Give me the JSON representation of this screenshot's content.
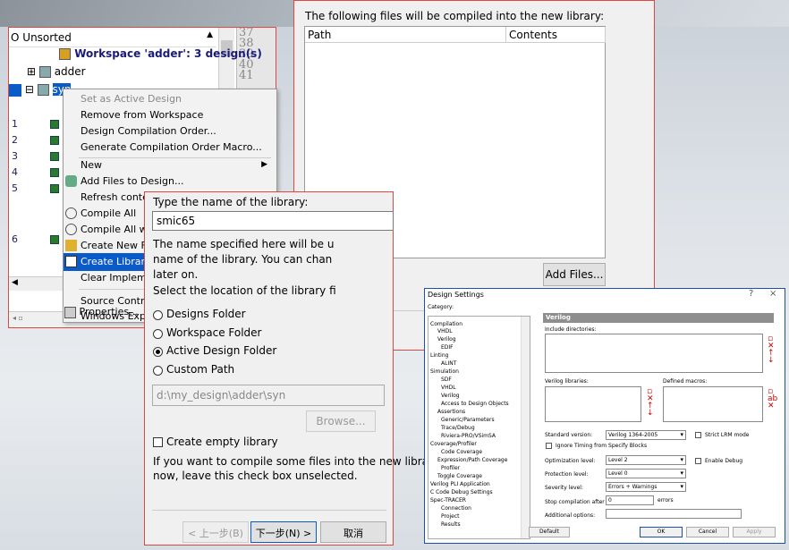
{
  "workspace": {
    "header": "Unsorted",
    "header_prefix": "O",
    "line_numbers": [
      "37",
      "38",
      "39",
      "40",
      "41"
    ],
    "workspace_label": "Workspace 'adder': 3 design(s)",
    "design1": "adder",
    "design2": "syn",
    "rows": [
      "1",
      "2",
      "3",
      "4",
      "5",
      "6"
    ]
  },
  "context_menu": {
    "items": [
      {
        "label": "Set as Active Design",
        "disabled": true
      },
      {
        "label": "Remove from Workspace"
      },
      {
        "label": "Design Compilation Order..."
      },
      {
        "label": "Generate Compilation Order Macro..."
      },
      {
        "label": "New"
      },
      {
        "label": "Add Files to Design..."
      },
      {
        "label": "Refresh contents..."
      },
      {
        "label": "Compile All"
      },
      {
        "label": "Compile All with"
      },
      {
        "label": "Create New Fo"
      },
      {
        "label": "Create Library..."
      },
      {
        "label": "Clear Implemen"
      },
      {
        "label": "Source Control"
      },
      {
        "label": "Windows Explo"
      },
      {
        "label": "Properties..."
      }
    ]
  },
  "compile_dialog": {
    "title": "The following files will be compiled into the new library:",
    "col_path": "Path",
    "col_contents": "Contents",
    "add_files": "Add Files..."
  },
  "library_dialog": {
    "prompt": "Type the name of the library:",
    "name_value": "smic65",
    "note1": "The name specified here will be u",
    "note2": "name of the library. You can chan",
    "note3": "later on.",
    "location_prompt": "Select the location of the library fi",
    "options": [
      "Designs Folder",
      "Workspace Folder",
      "Active Design Folder",
      "Custom Path"
    ],
    "selected_option": "Active Design Folder",
    "path_value": "d:\\my_design\\adder\\syn",
    "browse": "Browse...",
    "empty_lib": "Create empty library",
    "hint1": "If you want to compile some files into the new library",
    "hint2": "now, leave this check box unselected.",
    "back": "< 上一步(B)",
    "next": "下一步(N) >",
    "cancel": "取消"
  },
  "design_settings": {
    "title": "Design Settings",
    "help": "?",
    "close": "×",
    "category": "Category:",
    "tree": [
      "Compilation",
      "VHDL",
      "Verilog",
      "EDIF",
      "Linting",
      "ALINT",
      "Simulation",
      "SDF",
      "VHDL",
      "Verilog",
      "Access to Design Objects",
      "Assertions",
      "Generic/Parameters",
      "Trace/Debug",
      "Riviera-PRO/VSimSA",
      "Coverage/Profiler",
      "Code Coverage",
      "Expression/Path Coverage",
      "Profiler",
      "Toggle Coverage",
      "Verilog PLI Application",
      "C Code Debug Settings",
      "Spec-TRACER",
      "Connection",
      "Project",
      "Results"
    ],
    "banner": "Verilog",
    "include_dirs": "Include directories:",
    "verilog_libs": "Verilog libraries:",
    "defined_macros": "Defined macros:",
    "std_version_lbl": "Standard version:",
    "std_version": "Verilog 1364-2005",
    "strict_lrm": "Strict LRM mode",
    "ignore_timing": "Ignore Timing from Specify Blocks",
    "opt_lbl": "Optimization level:",
    "opt": "Level 2",
    "enable_debug": "Enable Debug",
    "prot_lbl": "Protection level:",
    "prot": "Level 0",
    "sev_lbl": "Severity level:",
    "sev": "Errors + Warnings",
    "stop_lbl": "Stop compilation after",
    "stop_val": "0",
    "errors": "errors",
    "additional": "Additional options:",
    "default_btn": "Default",
    "ok_btn": "OK",
    "cancel_btn": "Cancel",
    "apply_btn": "Apply"
  },
  "colors": {
    "accent_red": "#e0483f",
    "selection": "#0a5ac8",
    "ds_border": "#1b4fb3"
  }
}
